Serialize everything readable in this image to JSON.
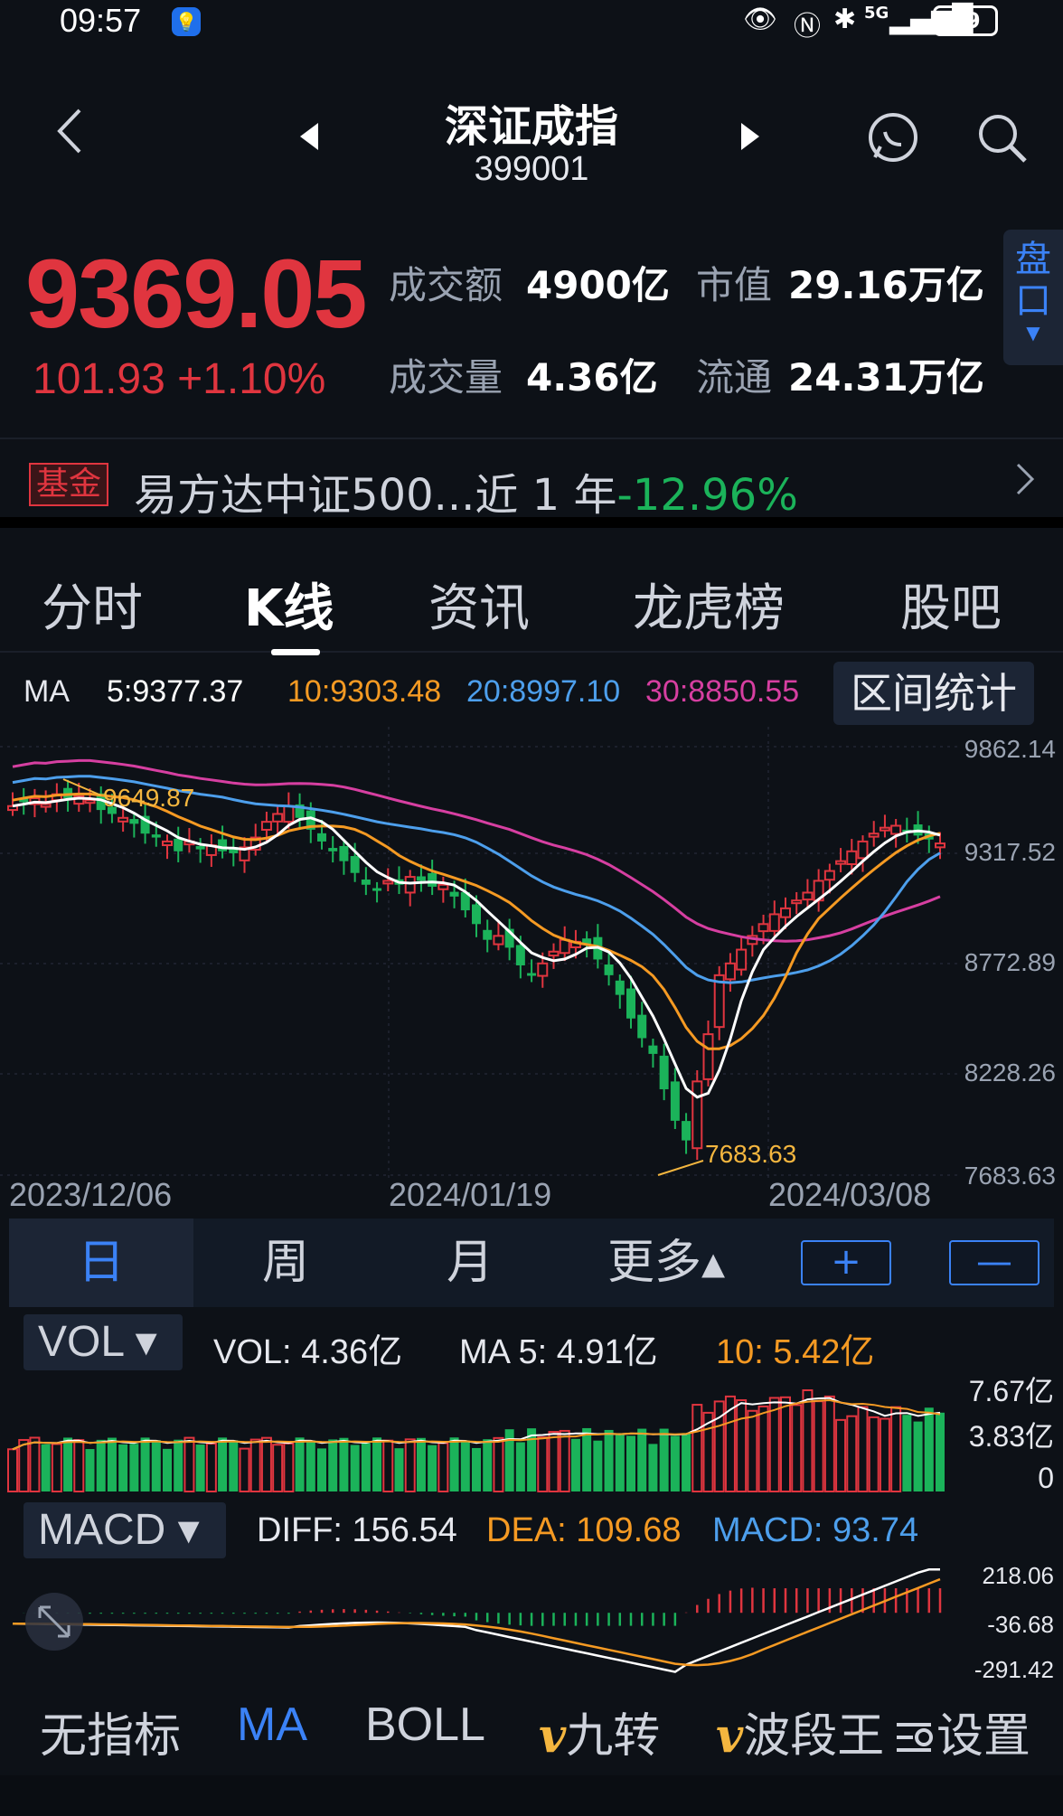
{
  "status_bar": {
    "time": "09:57",
    "battery": "79",
    "network": "5G"
  },
  "header": {
    "title": "深证成指",
    "code": "399001"
  },
  "quote": {
    "price": "9369.05",
    "change": "101.93 +1.10%",
    "turnover_label": "成交额",
    "turnover_value": "4900亿",
    "market_cap_label": "市值",
    "market_cap_value": "29.16万亿",
    "volume_label": "成交量",
    "volume_value": "4.36亿",
    "float_label": "流通",
    "float_value": "24.31万亿",
    "pankou_label": "盘口"
  },
  "fund_banner": {
    "tag": "基金",
    "name": "易方达中证500...近 1 年",
    "return": "-12.96%"
  },
  "tabs": [
    "分时",
    "K线",
    "资讯",
    "龙虎榜",
    "股吧"
  ],
  "active_tab": "K线",
  "ma": {
    "label": "MA",
    "ma5": "5:9377.37",
    "ma10": "10:9303.48",
    "ma20": "20:8997.10",
    "ma30": "30:8850.55",
    "range_stats": "区间统计"
  },
  "colors": {
    "up": "#e0353f",
    "down": "#1bb35a",
    "ma5": "#ffffff",
    "ma10": "#f59a23",
    "ma20": "#4d9fec",
    "ma30": "#d63fa1",
    "accent": "#3b82f6"
  },
  "kline": {
    "y_labels": [
      "9862.14",
      "9317.52",
      "8772.89",
      "8228.26",
      "7683.63"
    ],
    "x_labels": [
      "2023/12/06",
      "2024/01/19",
      "2024/03/08"
    ],
    "high_annotation": "9649.87",
    "low_annotation": "7683.63"
  },
  "periods": [
    "日",
    "周",
    "月",
    "更多▴"
  ],
  "period_buttons": {
    "plus": "+",
    "minus": "—"
  },
  "vol": {
    "selector": "VOL ▾",
    "vol_text": "VOL:  4.36亿",
    "ma5_text": "MA 5:  4.91亿",
    "ma10_text": "10:  5.42亿",
    "y_labels": [
      "7.67亿",
      "3.83亿",
      "0"
    ]
  },
  "macd": {
    "selector": "MACD ▾",
    "diff_text": "DIFF:  156.54",
    "dea_text": "DEA:  109.68",
    "macd_text": "MACD:  93.74",
    "y_labels": [
      "218.06",
      "-36.68",
      "-291.42"
    ]
  },
  "bottom_bar": {
    "none": "无指标",
    "ma": "MA",
    "boll": "BOLL",
    "jiuzhuan_v": "v",
    "jiuzhuan": "九转",
    "boduan_v": "v",
    "boduan": "波段王",
    "settings": "设置"
  }
}
